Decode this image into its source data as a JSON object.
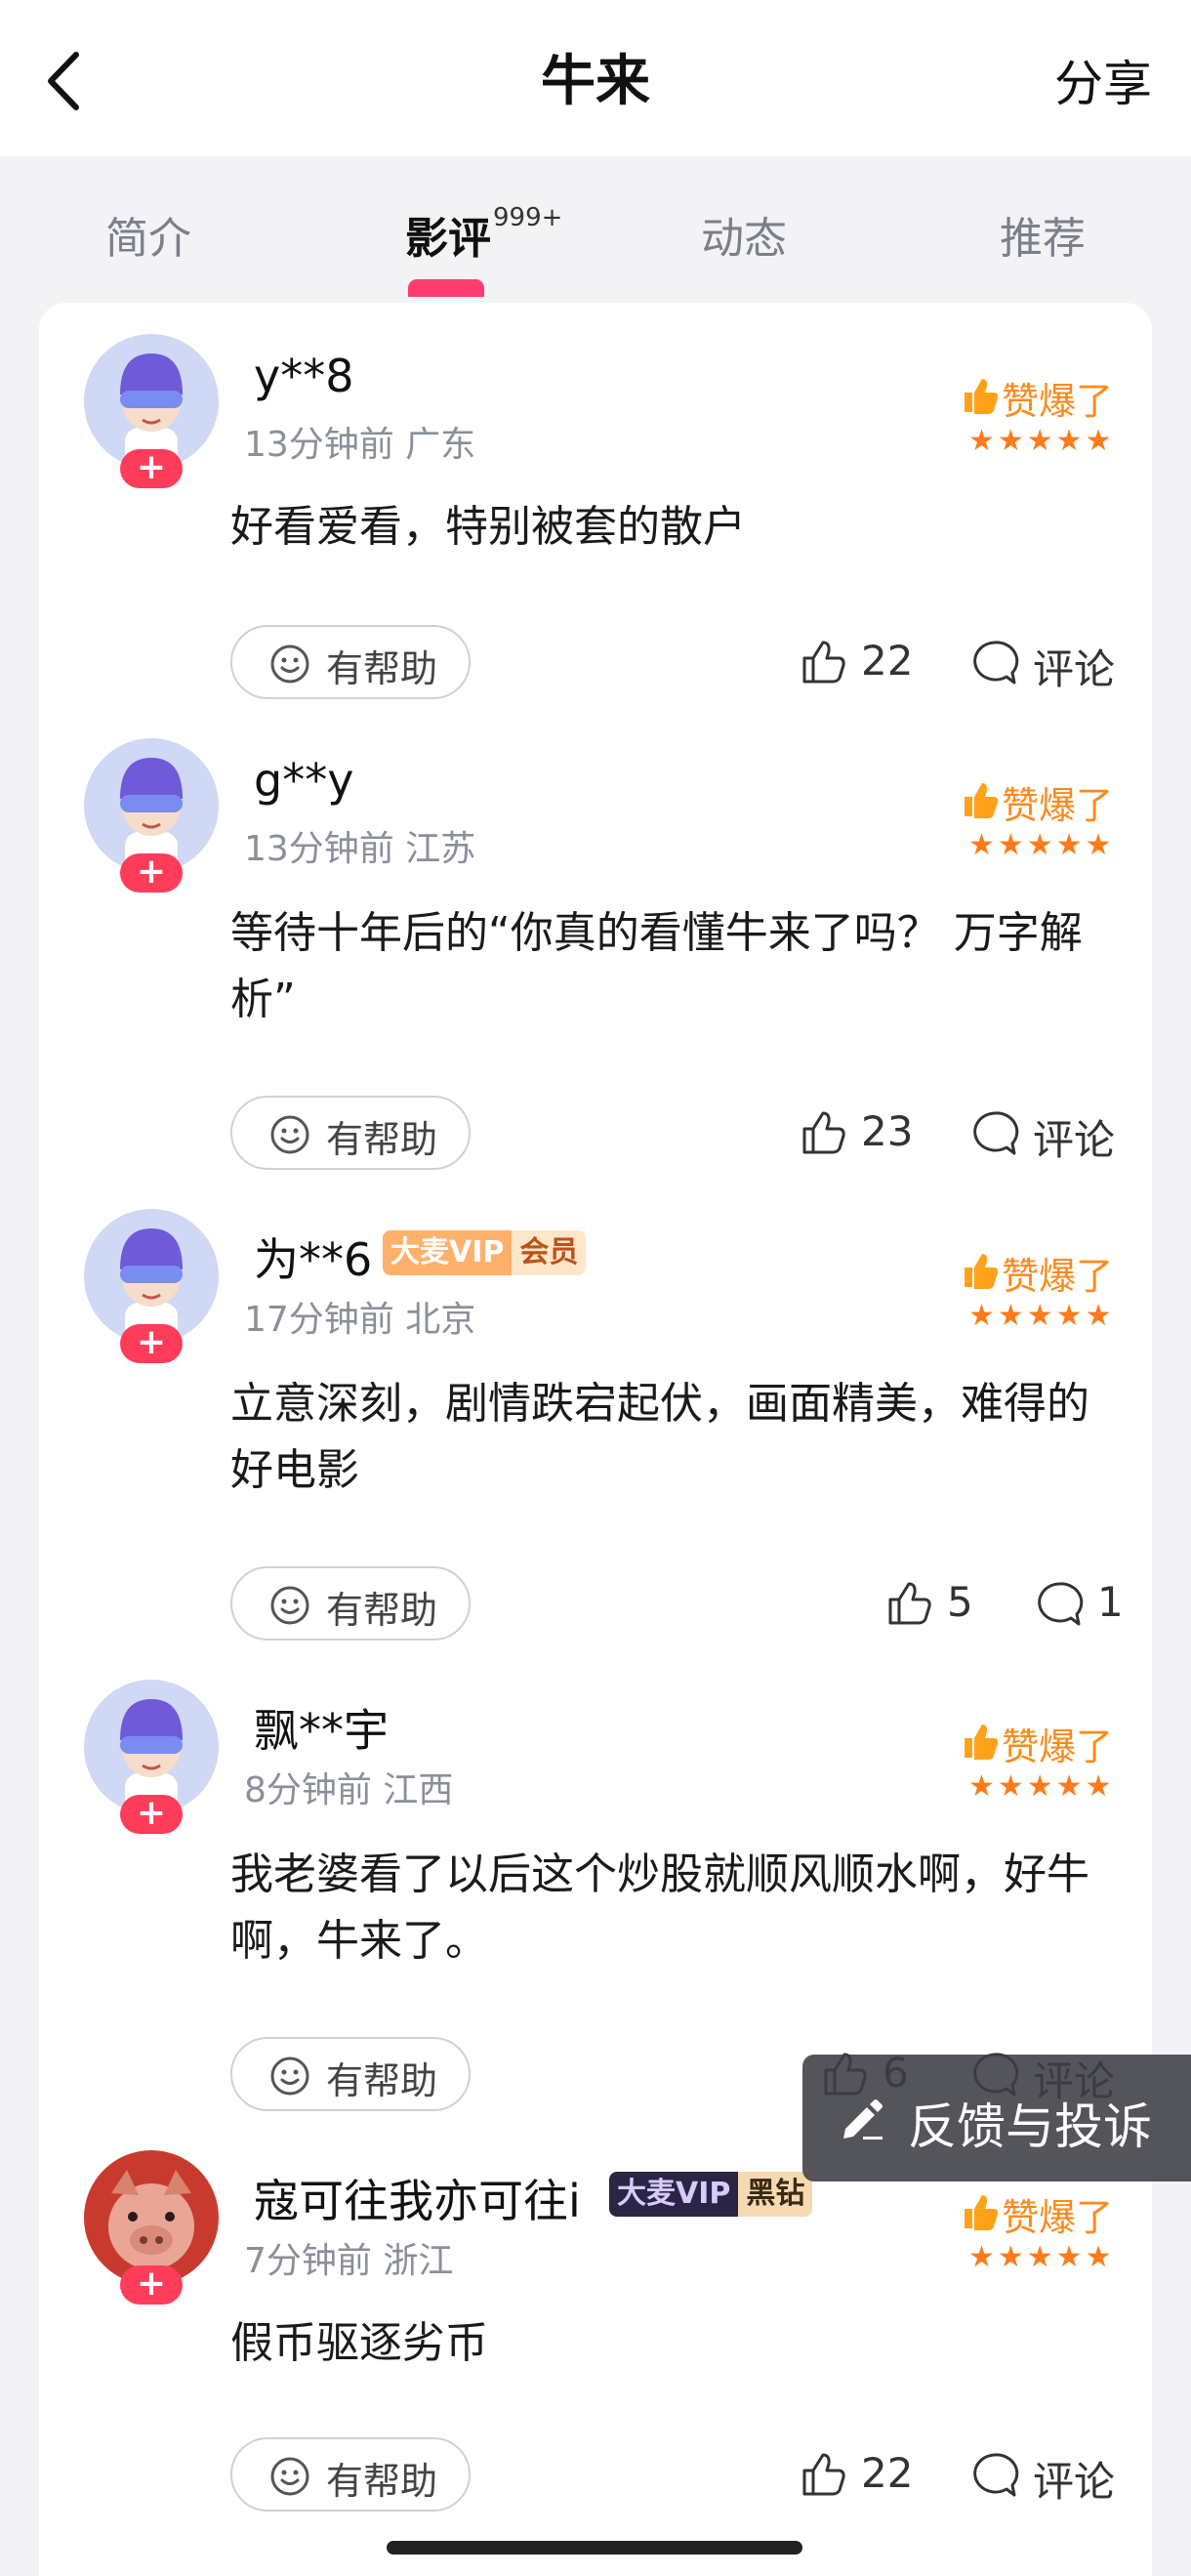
{
  "header": {
    "title": "牛来",
    "share_label": "分享"
  },
  "tabs": [
    {
      "label": "简介"
    },
    {
      "label": "影评",
      "badge": "999+"
    },
    {
      "label": "动态"
    },
    {
      "label": "推荐"
    }
  ],
  "reviews": [
    {
      "username": "y**8",
      "time": "13分钟前",
      "region": "广东",
      "rating_label": "赞爆了",
      "stars": "★★★★★",
      "content": "好看爱看，特别被套的散户",
      "helpful_label": "有帮助",
      "likes": "22",
      "comment_label": "评论"
    },
    {
      "username": "g**y",
      "time": "13分钟前",
      "region": "江苏",
      "rating_label": "赞爆了",
      "stars": "★★★★★",
      "content": "等待十年后的“你真的看懂牛来了吗？ 万字解析”",
      "helpful_label": "有帮助",
      "likes": "23",
      "comment_label": "评论"
    },
    {
      "username": "为**6",
      "vip_brand": "大麦VIP",
      "vip_tier": "会员",
      "time": "17分钟前",
      "region": "北京",
      "rating_label": "赞爆了",
      "stars": "★★★★★",
      "content": "立意深刻，剧情跌宕起伏，画面精美，难得的好电影",
      "helpful_label": "有帮助",
      "likes": "5",
      "comment_label": "1"
    },
    {
      "username": "飘**宇",
      "time": "8分钟前",
      "region": "江西",
      "rating_label": "赞爆了",
      "stars": "★★★★★",
      "content": "我老婆看了以后这个炒股就顺风顺水啊，好牛啊，牛来了。",
      "helpful_label": "有帮助",
      "likes": "6",
      "comment_label": "评论"
    },
    {
      "username": "寇可往我亦可往i",
      "vip_brand": "大麦VIP",
      "vip_tier": "黑钻",
      "time": "7分钟前",
      "region": "浙江",
      "rating_label": "赞爆了",
      "stars": "★★★★★",
      "content": "假币驱逐劣币",
      "helpful_label": "有帮助",
      "likes": "22",
      "comment_label": "评论"
    }
  ],
  "feedback": {
    "label": "反馈与投诉"
  },
  "colors": {
    "accent": "#ff3c6e",
    "rating": "#ff8a1a",
    "badge": "#ff3c5a"
  }
}
